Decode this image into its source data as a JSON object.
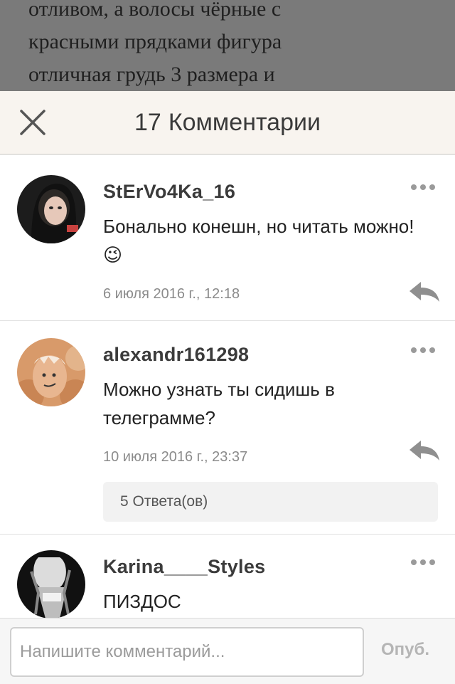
{
  "story": {
    "lines": [
      "отливом, а волосы чёрные с",
      "красными прядками фигура",
      "отличная грудь 3 размера и"
    ]
  },
  "header": {
    "count": "17",
    "title": "Комментарии"
  },
  "comments": [
    {
      "author": "StErVo4Ka_16",
      "text": "Бонально конешн, но читать можно!",
      "emoji": "😉",
      "date": "6 июля 2016 г., 12:18"
    },
    {
      "author": "alexandr161298",
      "text": "Можно узнать ты сидишь в телеграмме?",
      "date": "10 июля 2016 г., 23:37",
      "answers": "5 Ответа(ов)"
    },
    {
      "author": "Karina____Styles",
      "text": "ПИЗДОС"
    }
  ],
  "composer": {
    "placeholder": "Напишите комментарий...",
    "publish": "Опуб."
  }
}
